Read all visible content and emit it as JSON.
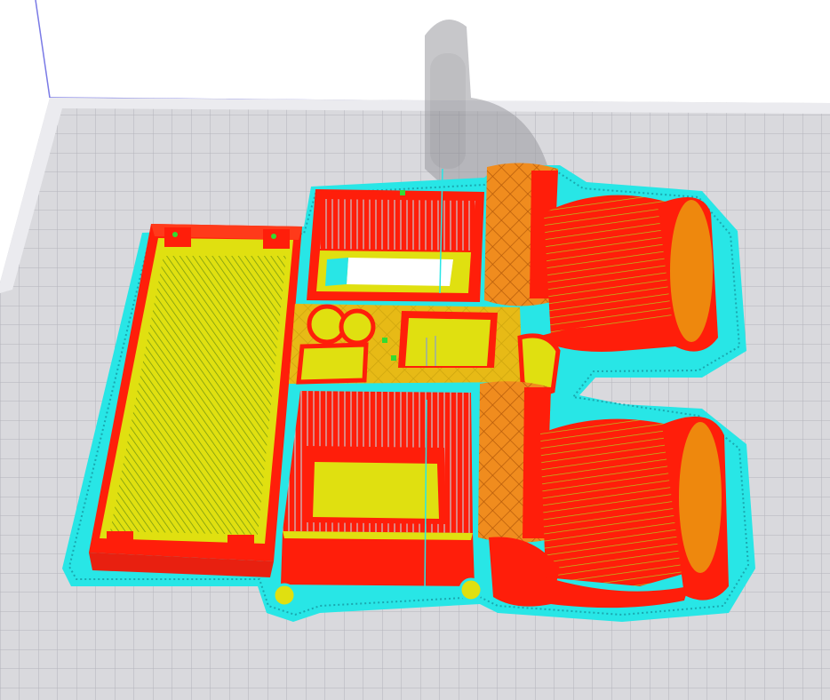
{
  "viewport": {
    "background": "#ffffff",
    "colors": {
      "build_plate": "#d9d9dd",
      "plate_grid": "#b4b4ba",
      "plate_border": "#ebebef",
      "volume_edge": "#7a7ae6",
      "skirt_brim": "#28e6e6",
      "wall_outer": "#ff1e0a",
      "infill": "#e0e010",
      "support": "#f08c1e",
      "wall_inner": "#32dc32",
      "travel": "#b4b4b4"
    },
    "objects": [
      {
        "name": "tray-left"
      },
      {
        "name": "box-top-middle"
      },
      {
        "name": "console-middle"
      },
      {
        "name": "box-bottom-middle"
      },
      {
        "name": "seat-top-right"
      },
      {
        "name": "seat-bottom-right"
      },
      {
        "name": "ghost-preview"
      }
    ]
  }
}
